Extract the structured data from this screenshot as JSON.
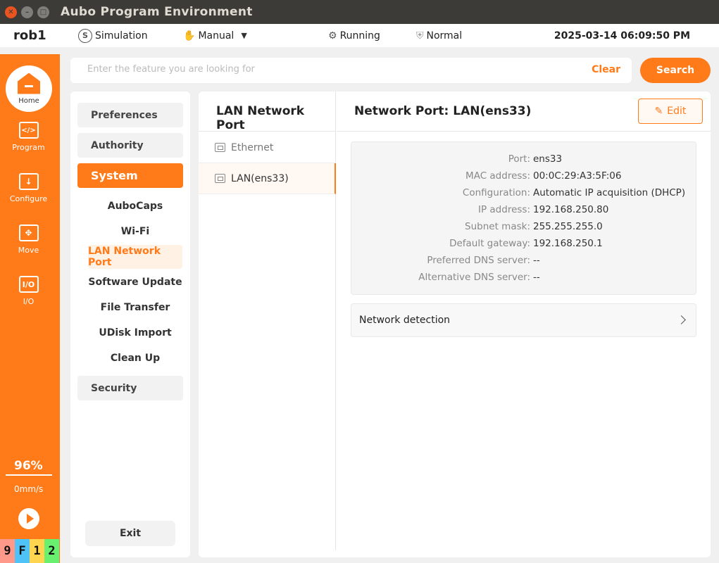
{
  "window": {
    "title": "Aubo Program Environment"
  },
  "status": {
    "robot_name": "rob1",
    "mode": "Simulation",
    "control": "Manual",
    "state": "Running",
    "safety": "Normal",
    "datetime": "2025-03-14 06:09:50 PM"
  },
  "nav": {
    "home": "Home",
    "program": "Program",
    "configure": "Configure",
    "move": "Move",
    "io": "I/O",
    "speed_percent": "96%",
    "speed": "0mm/s",
    "io_chips": [
      {
        "label": "9",
        "color": "#ff9a8a"
      },
      {
        "label": "F",
        "color": "#4fc3f7"
      },
      {
        "label": "1",
        "color": "#ffd54f"
      },
      {
        "label": "2",
        "color": "#69f06e"
      }
    ]
  },
  "search": {
    "placeholder": "Enter the feature you are looking for",
    "clear_label": "Clear",
    "search_label": "Search"
  },
  "menu": {
    "preferences": "Preferences",
    "authority": "Authority",
    "system": "System",
    "sub_items": [
      "AuboCaps",
      "Wi-Fi",
      "LAN Network Port",
      "Software Update",
      "File Transfer",
      "UDisk Import",
      "Clean Up"
    ],
    "security": "Security",
    "exit": "Exit"
  },
  "ports": {
    "title": "LAN Network Port",
    "items": [
      "Ethernet",
      "LAN(ens33)"
    ]
  },
  "detail": {
    "title": "Network Port: LAN(ens33)",
    "edit_label": "Edit",
    "rows": [
      {
        "label": "Port:",
        "value": "ens33"
      },
      {
        "label": "MAC address:",
        "value": "00:0C:29:A3:5F:06"
      },
      {
        "label": "Configuration:",
        "value": "Automatic IP acquisition (DHCP)"
      },
      {
        "label": "IP address:",
        "value": "192.168.250.80"
      },
      {
        "label": "Subnet mask:",
        "value": "255.255.255.0"
      },
      {
        "label": "Default gateway:",
        "value": "192.168.250.1"
      },
      {
        "label": "Preferred DNS server:",
        "value": "--"
      },
      {
        "label": "Alternative DNS server:",
        "value": "--"
      }
    ],
    "network_detection": "Network detection"
  },
  "colors": {
    "accent": "#ff7a18",
    "titlebar": "#3c3b37",
    "close": "#e95420"
  }
}
